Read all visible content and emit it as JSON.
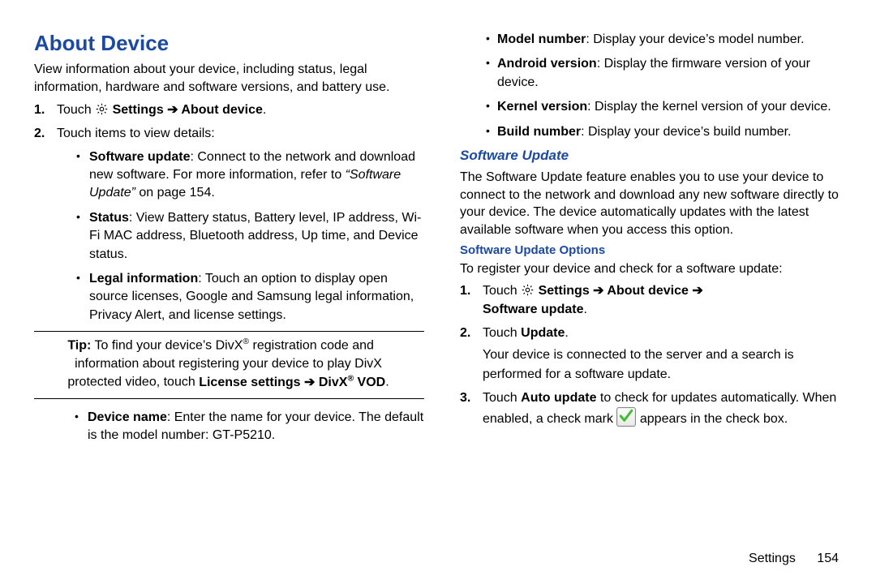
{
  "left": {
    "heading": "About Device",
    "intro": "View information about your device, including status, legal information, hardware and software versions, and battery use.",
    "step1_pre": "Touch ",
    "step1_nav": "Settings ➔ About device",
    "step2": "Touch items to view details:",
    "bullets": [
      {
        "t": "Software update",
        "d": ": Connect to the network and download new software. For more information, refer to ",
        "ref": "“Software Update”",
        "tail": " on page 154."
      },
      {
        "t": "Status",
        "d": ": View Battery status, Battery level, IP address, Wi-Fi MAC address, Bluetooth address, Up time, and Device status."
      },
      {
        "t": "Legal information",
        "d": ": Touch an option to display open source licenses, Google and Samsung legal information, Privacy Alert, and license settings."
      }
    ],
    "tip_pre": "Tip:",
    "tip_l1a": " To find your device’s DivX",
    "tip_l1b": " registration code and",
    "tip_l2": "information about registering your device to play DivX",
    "tip_l3_a": "protected video, touch ",
    "tip_l3_b": "License settings ➔ DivX",
    "tip_l3_c": " VOD",
    "dev_name_t": "Device name",
    "dev_name_d": ": Enter the name for your device. The default is the model number: GT-P5210."
  },
  "right": {
    "top_bullets": [
      {
        "t": "Model number",
        "d": ": Display your device’s model number."
      },
      {
        "t": "Android version",
        "d": ": Display the firmware version of your device."
      },
      {
        "t": "Kernel version",
        "d": ": Display the kernel version of your device."
      },
      {
        "t": "Build number",
        "d": ": Display your device’s build number."
      }
    ],
    "h2": "Software Update",
    "su_para": "The Software Update feature enables you to use your device to connect to the network and download any new software directly to your device. The device automatically updates with the latest available software when you access this option.",
    "h3": "Software Update Options",
    "reg": "To register your device and check for a software update:",
    "s1_pre": "Touch ",
    "s1_nav1": "Settings ➔ About device ➔",
    "s1_nav2": "Software update",
    "s2_a": "Touch ",
    "s2_b": "Update",
    "s2_c": "Your device is connected to the server and a search is performed for a software update.",
    "s3_a": "Touch ",
    "s3_b": "Auto update",
    "s3_c": " to check for updates automatically. When enabled, a check mark ",
    "s3_d": " appears in the check box."
  },
  "footer": {
    "label": "Settings",
    "page": "154"
  }
}
